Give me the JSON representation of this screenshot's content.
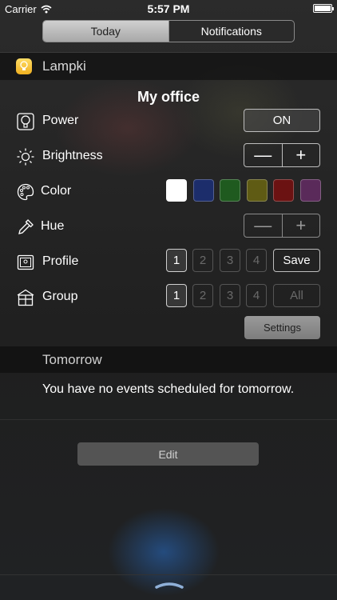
{
  "status_bar": {
    "carrier": "Carrier",
    "time": "5:57 PM"
  },
  "tabs": {
    "today": "Today",
    "notifications": "Notifications"
  },
  "widget": {
    "app_name": "Lampki",
    "device_name": "My office"
  },
  "rows": {
    "power": {
      "label": "Power",
      "value": "ON"
    },
    "brightness": {
      "label": "Brightness",
      "minus": "—",
      "plus": "+"
    },
    "color": {
      "label": "Color"
    },
    "hue": {
      "label": "Hue",
      "minus": "—",
      "plus": "+"
    },
    "profile": {
      "label": "Profile",
      "numbers": [
        "1",
        "2",
        "3",
        "4"
      ],
      "action": "Save"
    },
    "group": {
      "label": "Group",
      "numbers": [
        "1",
        "2",
        "3",
        "4"
      ],
      "action": "All"
    }
  },
  "colors": [
    "#ffffff",
    "#1c2d6b",
    "#1f5a1f",
    "#5f5b14",
    "#6b1212",
    "#5a2a5a"
  ],
  "settings_label": "Settings",
  "tomorrow": {
    "title": "Tomorrow",
    "message": "You have no events scheduled for tomorrow."
  },
  "edit_label": "Edit",
  "icons": [
    "wifi-icon",
    "battery-icon",
    "bulb-icon",
    "power-icon",
    "sun-icon",
    "palette-icon",
    "eyedropper-icon",
    "profile-icon",
    "house-icon",
    "chevron-up-icon"
  ]
}
